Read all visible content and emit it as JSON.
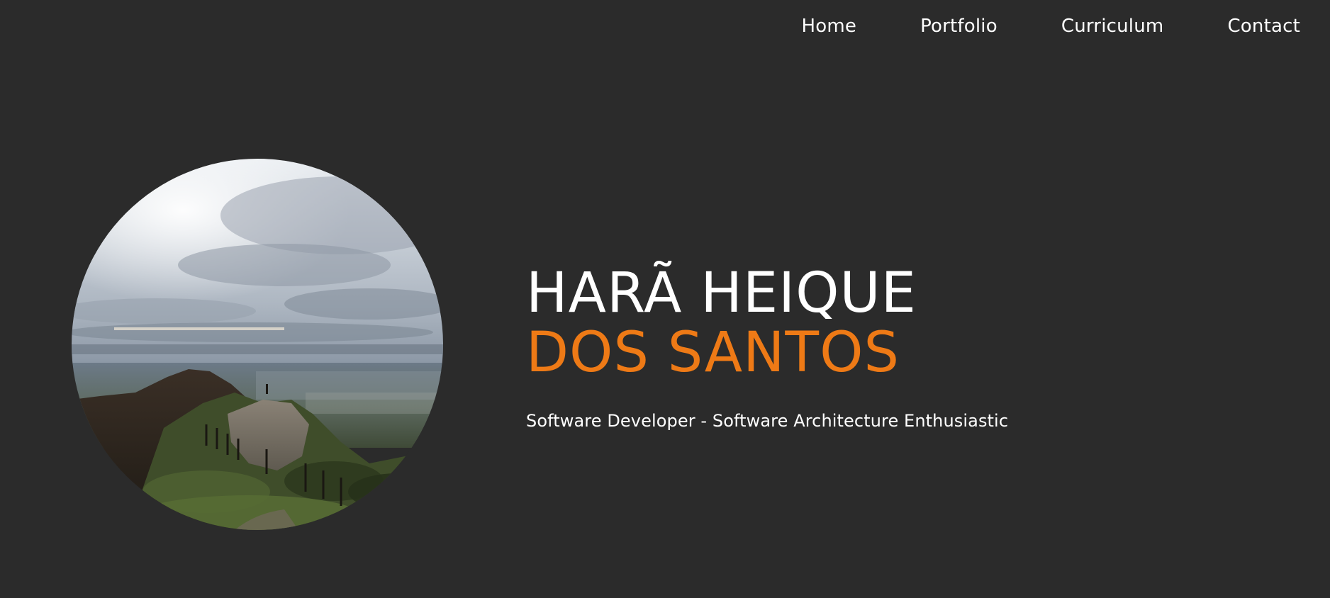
{
  "nav": {
    "items": [
      {
        "label": "Home"
      },
      {
        "label": "Portfolio"
      },
      {
        "label": "Curriculum"
      },
      {
        "label": "Contact"
      }
    ]
  },
  "hero": {
    "name_first": "HARÃ HEIQUE",
    "name_last": "DOS SANTOS",
    "tagline": "Software Developer - Software Architecture Enthusiastic"
  },
  "colors": {
    "background": "#2b2b2b",
    "accent": "#ee7a16",
    "text": "#ffffff"
  }
}
